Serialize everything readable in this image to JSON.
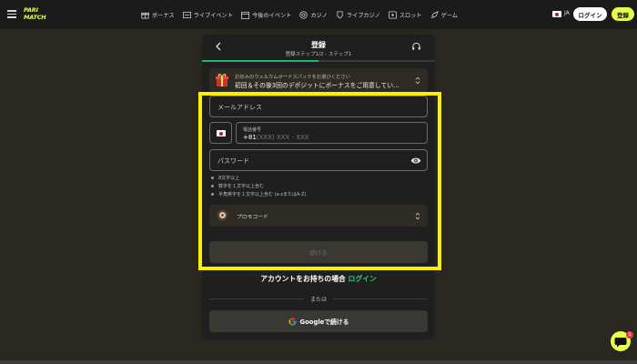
{
  "brand": {
    "line1": "PARI",
    "line2": "MATCH",
    "accent": "#e9ff4a"
  },
  "nav": [
    {
      "icon": "gift-icon",
      "label": "ボーナス"
    },
    {
      "icon": "live-event-icon",
      "label": "ライブイベント"
    },
    {
      "icon": "calendar-icon",
      "label": "今後のイベント"
    },
    {
      "icon": "casino-chip-icon",
      "label": "カジノ"
    },
    {
      "icon": "live-casino-icon",
      "label": "ライブカジノ"
    },
    {
      "icon": "slot-icon",
      "label": "スロット"
    },
    {
      "icon": "rocket-icon",
      "label": "ゲーム"
    }
  ],
  "header_right": {
    "lang": "JA",
    "login": "ログイン",
    "register": "登録"
  },
  "modal": {
    "title": "登録",
    "subtitle": "登録ステップ1/2 - ステップ1",
    "progress": 0.5,
    "bonus": {
      "small": "お好みのウェルカムボーナスパックをお選びください",
      "main": "初回＆その後3回のデポジットにボーナスをご用意してい..."
    },
    "email_placeholder": "メールアドレス",
    "phone": {
      "label": "電話番号",
      "code": "+81",
      "placeholder": "(XXX) XXX - XXX"
    },
    "password_placeholder": "パスワード",
    "rules": [
      "8文字以上",
      "数字を１文字以上含む",
      "半角英字を１文字以上含む (a-zまたはA-Z)"
    ],
    "promo_label": "プロモコード",
    "continue_label": "続ける",
    "has_account_text": "アカウントをお持ちの場合",
    "login_link": "ログイン",
    "or_text": "または",
    "google_label": "Googleで続ける"
  },
  "chat_badge": "1"
}
